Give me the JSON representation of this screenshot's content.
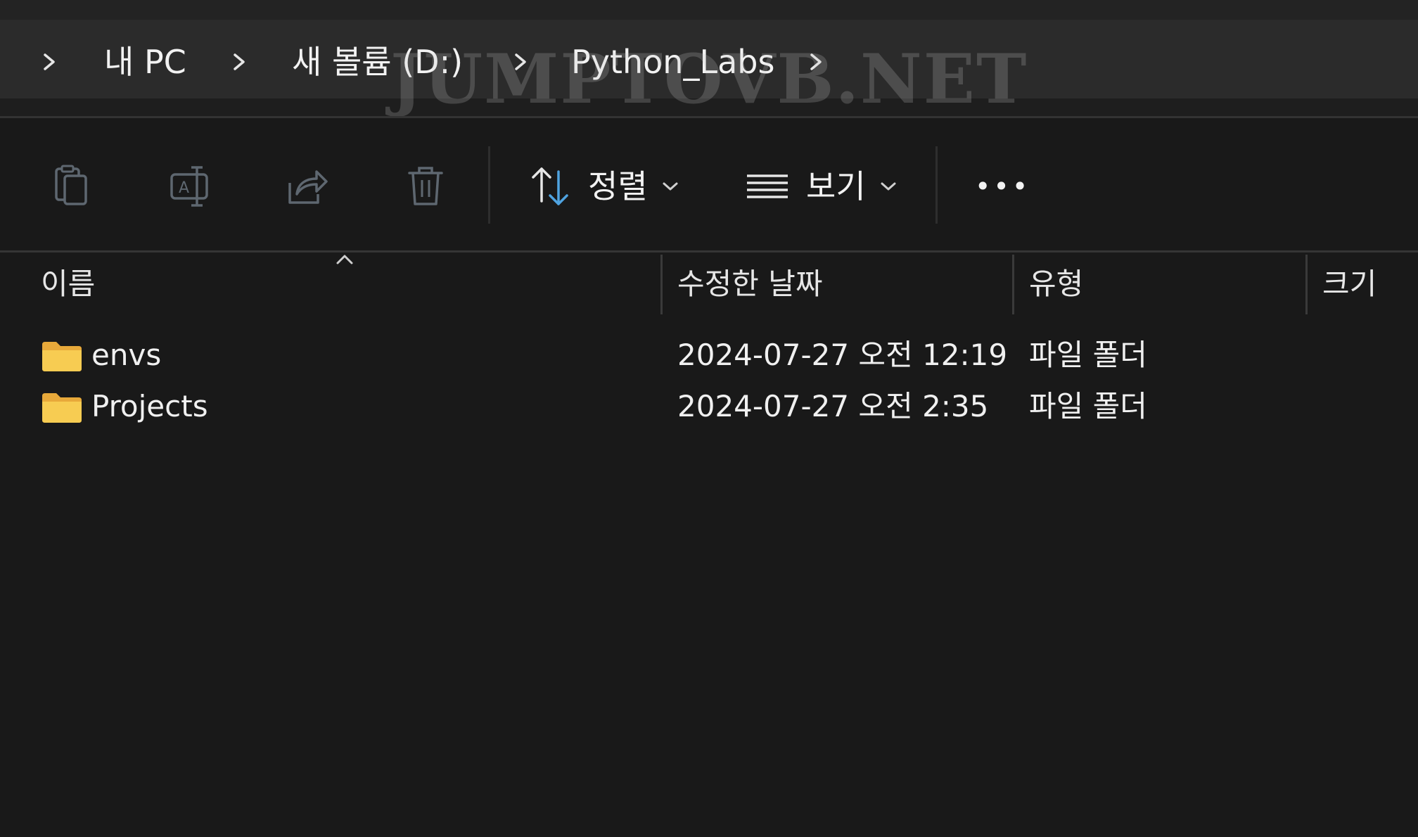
{
  "breadcrumb": {
    "items": [
      "내 PC",
      "새 볼륨 (D:)",
      "Python_Labs"
    ]
  },
  "watermark": "JUMPTOVB.NET",
  "toolbar": {
    "sort_label": "정렬",
    "view_label": "보기",
    "more_label": "•••"
  },
  "columns": {
    "name": "이름",
    "modified": "수정한 날짜",
    "type": "유형",
    "size": "크기"
  },
  "files": [
    {
      "name": "envs",
      "modified": "2024-07-27 오전 12:19",
      "type": "파일 폴더",
      "size": ""
    },
    {
      "name": "Projects",
      "modified": "2024-07-27 오전 2:35",
      "type": "파일 폴더",
      "size": ""
    }
  ],
  "colors": {
    "background": "#191919",
    "address_bar": "#2b2b2b",
    "accent": "#4fa3e0",
    "folder": "#f5c542"
  }
}
